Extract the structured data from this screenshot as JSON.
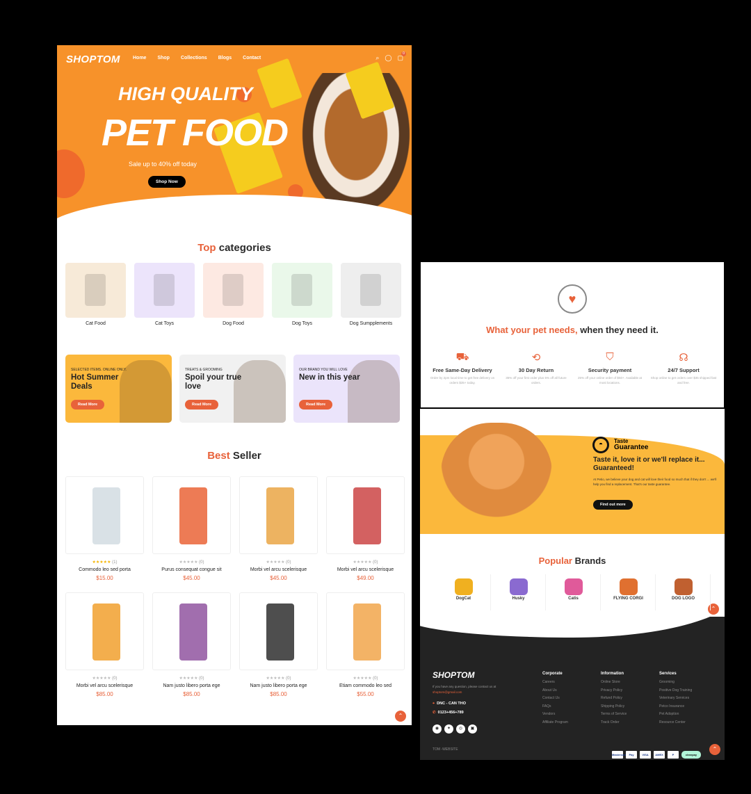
{
  "header": {
    "logo": "SHOPTOM",
    "nav": [
      "Home",
      "Shop",
      "Collections",
      "Blogs",
      "Contact"
    ],
    "cart_count": "0"
  },
  "hero": {
    "line1": "HIGH QUALITY",
    "line2": "PET FOOD",
    "subtitle": "Sale up to 40% off today",
    "cta": "Shop Now"
  },
  "categories": {
    "title_accent": "Top",
    "title_rest": " categories",
    "items": [
      {
        "label": "Cat Food",
        "bg": "#f7ead8"
      },
      {
        "label": "Cat Toys",
        "bg": "#ece4fb"
      },
      {
        "label": "Dog Food",
        "bg": "#fde9e2"
      },
      {
        "label": "Dog Toys",
        "bg": "#eaf8ea"
      },
      {
        "label": "Dog Sumpplements",
        "bg": "#eeeeee"
      }
    ]
  },
  "promos": [
    {
      "kicker": "SELECTED ITEMS. ONLINE ONLY.",
      "title": "Hot Summer Deals",
      "button": "Read More",
      "bg": "#fbb83c"
    },
    {
      "kicker": "TREATS & GROOMING",
      "title": "Spoil your true love",
      "button": "Read More",
      "bg": "#f1f1f1"
    },
    {
      "kicker": "OUR BRAND YOU WILL LOVE",
      "title": "New in this year",
      "button": "Read More",
      "bg": "#ebe4fb"
    }
  ],
  "best_seller": {
    "title_accent": "Best",
    "title_rest": " Seller",
    "products": [
      {
        "name": "Commodo leo sed porta",
        "price": "$15.00",
        "rating": 5,
        "reviews": "(1)"
      },
      {
        "name": "Purus consequat congue sit",
        "price": "$45.00",
        "rating": 0,
        "reviews": "(0)"
      },
      {
        "name": "Morbi vel arcu scelerisque",
        "price": "$45.00",
        "rating": 0,
        "reviews": "(0)"
      },
      {
        "name": "Morbi vel arcu scelerisque",
        "price": "$49.00",
        "rating": 0,
        "reviews": "(0)"
      },
      {
        "name": "Morbi vel arcu scelerisque",
        "price": "$85.00",
        "rating": 0,
        "reviews": "(0)"
      },
      {
        "name": "Nam justo libero porta ege",
        "price": "$85.00",
        "rating": 0,
        "reviews": "(0)"
      },
      {
        "name": "Nam justo libero porta ege",
        "price": "$85.00",
        "rating": 0,
        "reviews": "(0)"
      },
      {
        "name": "Etiam commodo leo sed",
        "price": "$55.00",
        "rating": 0,
        "reviews": "(0)"
      }
    ]
  },
  "needs": {
    "title_accent": "What your pet needs,",
    "title_rest": " when they need it.",
    "features": [
      {
        "icon": "truck-icon",
        "title": "Free Same-Day Delivery",
        "desc": "Order by 2pm local time to get free delivery on orders $35+ today."
      },
      {
        "icon": "return-box-icon",
        "title": "30 Day Return",
        "desc": "35% off your first order plus 5% off all future orders."
      },
      {
        "icon": "shield-check-icon",
        "title": "Security payment",
        "desc": "25% off your online order of $50+. Available at most locations."
      },
      {
        "icon": "headset-icon",
        "title": "24/7 Support",
        "desc": "Shop online to get orders over $35 shipped fast and free."
      }
    ]
  },
  "taste": {
    "label1": "Taste",
    "label2": "Guarantee",
    "headline": "Taste it, love it or we'll replace it... Guaranteed!",
    "body": "At Petio, we believe your dog and cat will love their food so much that if they don't ... we'll help you find a replacement. That's our taste guarantee.",
    "cta": "Find out more",
    "bg": "#fbb83c"
  },
  "brands": {
    "title_accent": "Popular",
    "title_rest": " Brands",
    "items": [
      "DogCat",
      "Husky",
      "Catis",
      "FLYING CORGI",
      "DOG LOGO"
    ]
  },
  "footer": {
    "logo": "SHOPTOM",
    "intro": "If you have any question, please contact us at",
    "email": "shoptom@gmail.com",
    "address": "DNC - CAN THO",
    "phone": "0123+456+789",
    "copyright": "TOM -WEBSITE",
    "columns": [
      {
        "heading": "Corporate",
        "links": [
          "Careers",
          "About Us",
          "Contact Us",
          "FAQs",
          "Vendors",
          "Affiliate Program"
        ]
      },
      {
        "heading": "Information",
        "links": [
          "Online Store",
          "Privacy Policy",
          "Refund Policy",
          "Shipping Policy",
          "Terms of Service",
          "Track Order"
        ]
      },
      {
        "heading": "Services",
        "links": [
          "Grooming",
          "Positive Dog Training",
          "Veterinary Services",
          "Petco Insurance",
          "Pet Adoption",
          "Resource Center"
        ]
      }
    ],
    "payments": [
      "Mastercard",
      "Pay",
      "VISA",
      "AMEX",
      "P",
      "clearpay"
    ]
  },
  "colors": {
    "accent": "#e8623a",
    "hero": "#f7922a",
    "footer": "#232323"
  }
}
